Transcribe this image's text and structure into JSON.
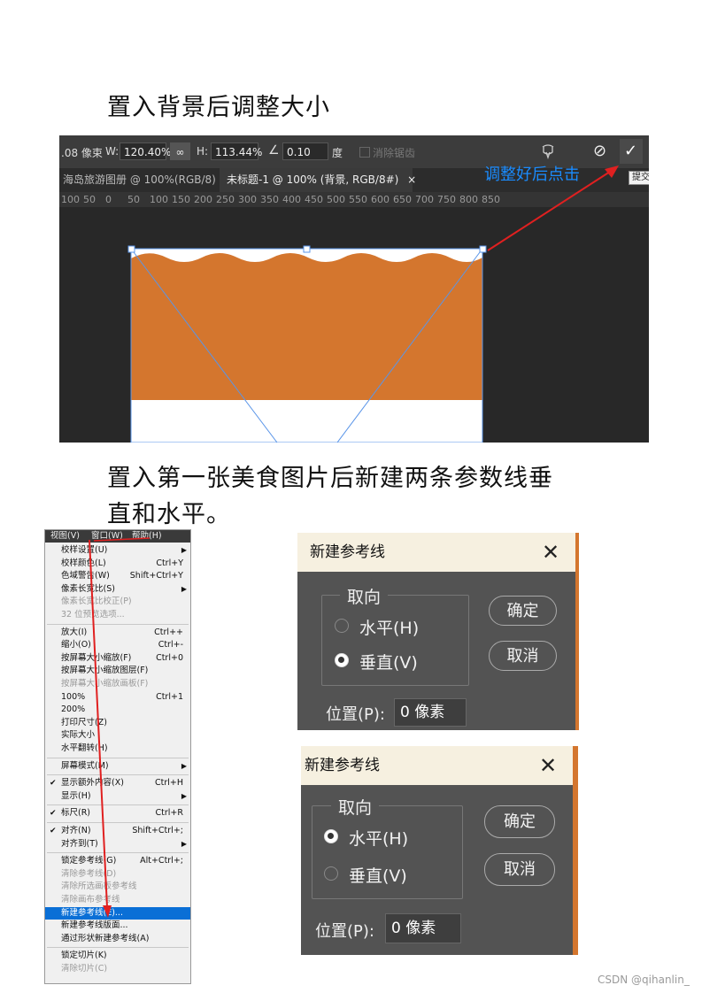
{
  "heading1": "置入背景后调整大小",
  "heading2_line1": "置入第一张美食图片后新建两条参数线垂",
  "heading2_line2": "直和水平。",
  "screenshot1": {
    "optbar": {
      "pos_value": ".08 像束",
      "w_label": "W:",
      "w_value": "120.40%",
      "link_icon": "∞",
      "h_label": "H:",
      "h_value": "113.44%",
      "angle_icon": "∠",
      "angle_value": "0.10",
      "angle_unit": "度",
      "antialias_label": "消除锯齿",
      "cancel_icon": "⊘",
      "commit_icon": "✓"
    },
    "tabs": [
      {
        "label": "海岛旅游图册 @ 100%(RGB/8)",
        "close": "×"
      },
      {
        "label": "未标题-1 @ 100% (背景, RGB/8#)",
        "close": "×"
      }
    ],
    "ruler_ticks": [
      "100",
      "50",
      "0",
      "50",
      "100",
      "150",
      "200",
      "250",
      "300",
      "350",
      "400",
      "450",
      "500",
      "550",
      "600",
      "650",
      "700",
      "750",
      "800",
      "850"
    ],
    "callout": "调整好后点击",
    "tooltip": "提交"
  },
  "menu": {
    "bar": [
      "视图(V)",
      "窗口(W)",
      "帮助(H)"
    ],
    "items": [
      {
        "label": "校样设置(U)",
        "shortcut": "",
        "arrow": true,
        "check": false,
        "disabled": false
      },
      {
        "label": "校样颜色(L)",
        "shortcut": "Ctrl+Y",
        "arrow": false,
        "check": false,
        "disabled": false
      },
      {
        "label": "色域警告(W)",
        "shortcut": "Shift+Ctrl+Y",
        "arrow": false,
        "check": false,
        "disabled": false
      },
      {
        "label": "像素长宽比(S)",
        "shortcut": "",
        "arrow": true,
        "check": false,
        "disabled": false
      },
      {
        "label": "像素长宽比校正(P)",
        "shortcut": "",
        "arrow": false,
        "check": false,
        "disabled": true
      },
      {
        "label": "32 位预览选项...",
        "shortcut": "",
        "arrow": false,
        "check": false,
        "disabled": true
      },
      {
        "sep": true
      },
      {
        "label": "放大(I)",
        "shortcut": "Ctrl++",
        "arrow": false,
        "check": false,
        "disabled": false
      },
      {
        "label": "缩小(O)",
        "shortcut": "Ctrl+-",
        "arrow": false,
        "check": false,
        "disabled": false
      },
      {
        "label": "按屏幕大小缩放(F)",
        "shortcut": "Ctrl+0",
        "arrow": false,
        "check": false,
        "disabled": false
      },
      {
        "label": "按屏幕大小缩放图层(F)",
        "shortcut": "",
        "arrow": false,
        "check": false,
        "disabled": false
      },
      {
        "label": "按屏幕大小缩放画板(F)",
        "shortcut": "",
        "arrow": false,
        "check": false,
        "disabled": true
      },
      {
        "label": "100%",
        "shortcut": "Ctrl+1",
        "arrow": false,
        "check": false,
        "disabled": false
      },
      {
        "label": "200%",
        "shortcut": "",
        "arrow": false,
        "check": false,
        "disabled": false
      },
      {
        "label": "打印尺寸(Z)",
        "shortcut": "",
        "arrow": false,
        "check": false,
        "disabled": false
      },
      {
        "label": "实际大小",
        "shortcut": "",
        "arrow": false,
        "check": false,
        "disabled": false
      },
      {
        "label": "水平翻转(H)",
        "shortcut": "",
        "arrow": false,
        "check": false,
        "disabled": false
      },
      {
        "sep": true
      },
      {
        "label": "屏幕模式(M)",
        "shortcut": "",
        "arrow": true,
        "check": false,
        "disabled": false
      },
      {
        "sep": true
      },
      {
        "label": "显示额外内容(X)",
        "shortcut": "Ctrl+H",
        "arrow": false,
        "check": true,
        "disabled": false
      },
      {
        "label": "显示(H)",
        "shortcut": "",
        "arrow": true,
        "check": false,
        "disabled": false
      },
      {
        "sep": true
      },
      {
        "label": "标尺(R)",
        "shortcut": "Ctrl+R",
        "arrow": false,
        "check": true,
        "disabled": false
      },
      {
        "sep": true
      },
      {
        "label": "对齐(N)",
        "shortcut": "Shift+Ctrl+;",
        "arrow": false,
        "check": true,
        "disabled": false
      },
      {
        "label": "对齐到(T)",
        "shortcut": "",
        "arrow": true,
        "check": false,
        "disabled": false
      },
      {
        "sep": true
      },
      {
        "label": "锁定参考线(G)",
        "shortcut": "Alt+Ctrl+;",
        "arrow": false,
        "check": false,
        "disabled": false
      },
      {
        "label": "清除参考线(D)",
        "shortcut": "",
        "arrow": false,
        "check": false,
        "disabled": true
      },
      {
        "label": "清除所选画板参考线",
        "shortcut": "",
        "arrow": false,
        "check": false,
        "disabled": true
      },
      {
        "label": "清除画布参考线",
        "shortcut": "",
        "arrow": false,
        "check": false,
        "disabled": true
      },
      {
        "label": "新建参考线(E)...",
        "shortcut": "",
        "arrow": false,
        "check": false,
        "disabled": false,
        "selected": true
      },
      {
        "label": "新建参考线版面...",
        "shortcut": "",
        "arrow": false,
        "check": false,
        "disabled": false
      },
      {
        "label": "通过形状新建参考线(A)",
        "shortcut": "",
        "arrow": false,
        "check": false,
        "disabled": false
      },
      {
        "sep": true
      },
      {
        "label": "锁定切片(K)",
        "shortcut": "",
        "arrow": false,
        "check": false,
        "disabled": false
      },
      {
        "label": "清除切片(C)",
        "shortcut": "",
        "arrow": false,
        "check": false,
        "disabled": true
      }
    ]
  },
  "dialog_vertical": {
    "title": "新建参考线",
    "close": "✕",
    "group_label": "取向",
    "options": [
      "水平(H)",
      "垂直(V)"
    ],
    "selected": "垂直(V)",
    "ok": "确定",
    "cancel": "取消",
    "position_label": "位置(P):",
    "position_value": "0 像素"
  },
  "dialog_horizontal": {
    "title": "新建参考线",
    "close": "✕",
    "group_label": "取向",
    "options": [
      "水平(H)",
      "垂直(V)"
    ],
    "selected": "水平(H)",
    "ok": "确定",
    "cancel": "取消",
    "position_label": "位置(P):",
    "position_value": "0 像素"
  },
  "footer": "CSDN @qihanlin_",
  "colors": {
    "image_orange": "#d4762e",
    "highlight_blue": "#0a6fd6",
    "callout_blue": "#1a8cff",
    "arrow_red": "#e02020",
    "guide_blue": "#5a95e8"
  }
}
